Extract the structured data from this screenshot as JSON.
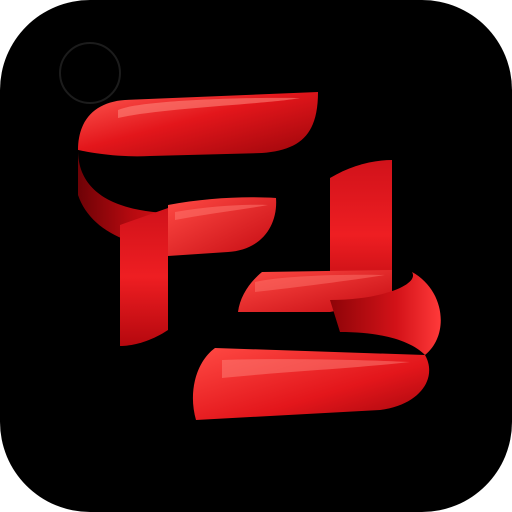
{
  "app_icon": {
    "icon": "f4-monogram-logo-icon",
    "colors": {
      "background": "#000000",
      "ribbon_light": "#ff3a3a",
      "ribbon_mid": "#e3161b",
      "ribbon_dark": "#8e0408"
    }
  }
}
